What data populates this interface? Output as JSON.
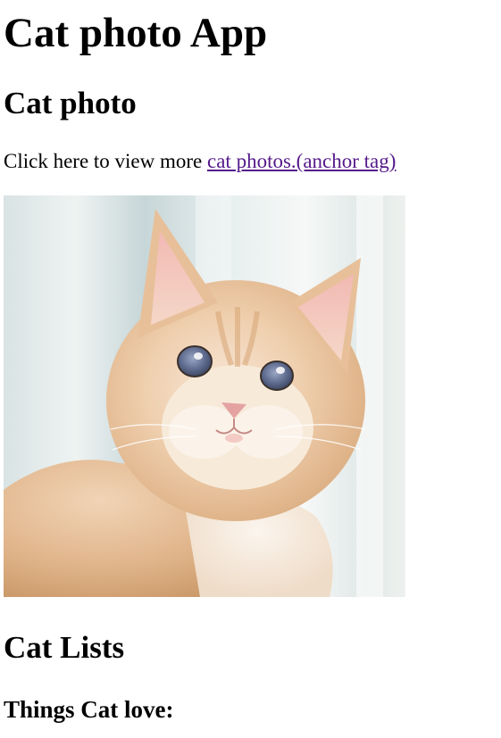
{
  "page": {
    "title": "Cat photo App"
  },
  "photo_section": {
    "heading": "Cat photo",
    "intro_text": "Click here to view more ",
    "link_text": "cat photos.(anchor tag)",
    "image_alt": "Orange and white kitten with blue eyes"
  },
  "lists_section": {
    "heading": "Cat Lists",
    "subheading": "Things Cat love:"
  },
  "colors": {
    "link_visited": "#551a8b",
    "text": "#000000",
    "background": "#ffffff"
  }
}
